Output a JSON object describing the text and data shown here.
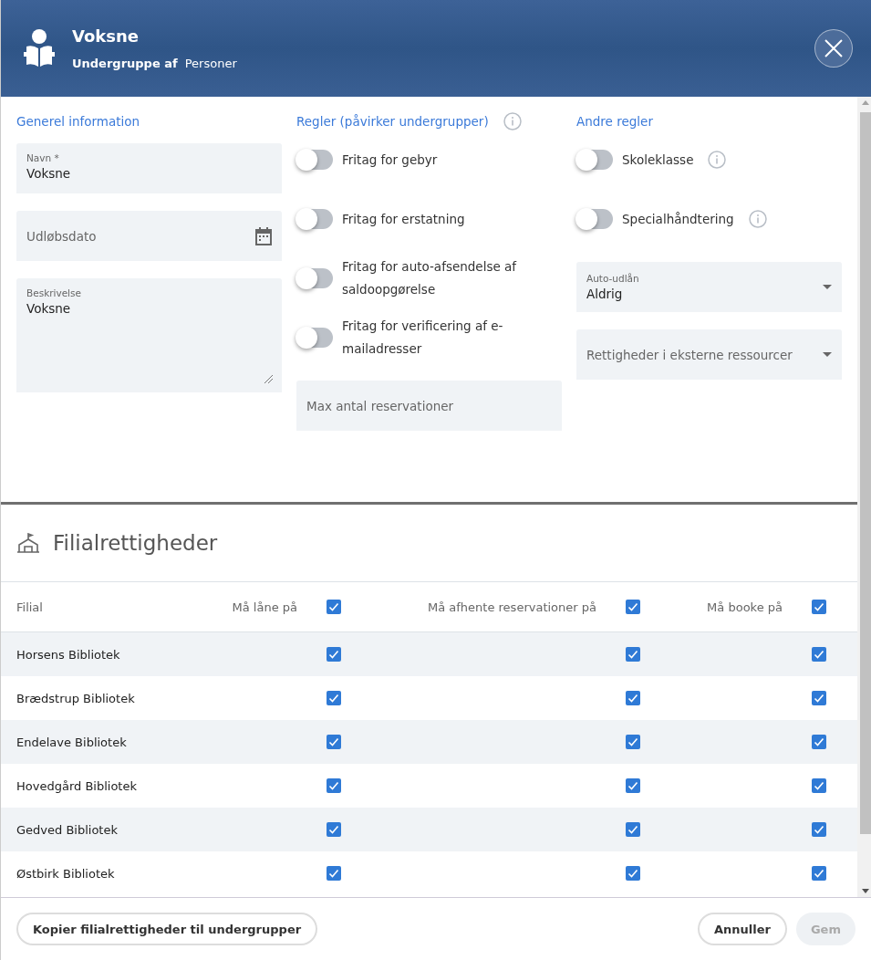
{
  "header": {
    "title": "Voksne",
    "subtitle_label": "Undergruppe af",
    "subtitle_value": "Personer"
  },
  "general": {
    "heading": "Generel information",
    "fields": [
      {
        "kind": "text",
        "label": "Navn *",
        "value": "Voksne"
      },
      {
        "kind": "date",
        "placeholder": "Udløbsdato"
      },
      {
        "kind": "textarea",
        "label": "Beskrivelse",
        "value": "Voksne"
      }
    ]
  },
  "rules": {
    "heading": "Regler (påvirker undergrupper)",
    "toggles": [
      {
        "label": "Fritag for gebyr",
        "on": false
      },
      {
        "label": "Fritag for erstatning",
        "on": false
      },
      {
        "label": "Fritag for auto-afsendelse af saldoopgørelse",
        "on": false
      },
      {
        "label": "Fritag for verificering af e-mailadresser",
        "on": false
      }
    ],
    "field": {
      "placeholder": "Max antal reservationer"
    }
  },
  "other": {
    "heading": "Andre regler",
    "toggles": [
      {
        "label": "Skoleklasse",
        "on": false
      },
      {
        "label": "Specialhåndtering",
        "on": false
      }
    ],
    "selects": [
      {
        "label": "Auto-udlån",
        "value": "Aldrig"
      },
      {
        "placeholder": "Rettigheder i eksterne ressourcer"
      }
    ]
  },
  "branches": {
    "title": "Filialrettigheder",
    "name_column": "Filial",
    "columns": [
      {
        "label": "Må låne på",
        "checked": true
      },
      {
        "label": "Må afhente reservationer på",
        "checked": true
      },
      {
        "label": "Må booke på",
        "checked": true
      }
    ],
    "rows": [
      {
        "name": "Horsens Bibliotek",
        "checks": [
          true,
          true,
          true
        ]
      },
      {
        "name": "Brædstrup Bibliotek",
        "checks": [
          true,
          true,
          true
        ]
      },
      {
        "name": "Endelave Bibliotek",
        "checks": [
          true,
          true,
          true
        ]
      },
      {
        "name": "Hovedgård Bibliotek",
        "checks": [
          true,
          true,
          true
        ]
      },
      {
        "name": "Gedved Bibliotek",
        "checks": [
          true,
          true,
          true
        ]
      },
      {
        "name": "Østbirk Bibliotek",
        "checks": [
          true,
          true,
          true
        ]
      }
    ]
  },
  "footer": {
    "copy_button": "Kopier filialrettigheder til undergrupper",
    "cancel_button": "Annuller",
    "save_button": {
      "label": "Gem",
      "disabled": true
    }
  }
}
